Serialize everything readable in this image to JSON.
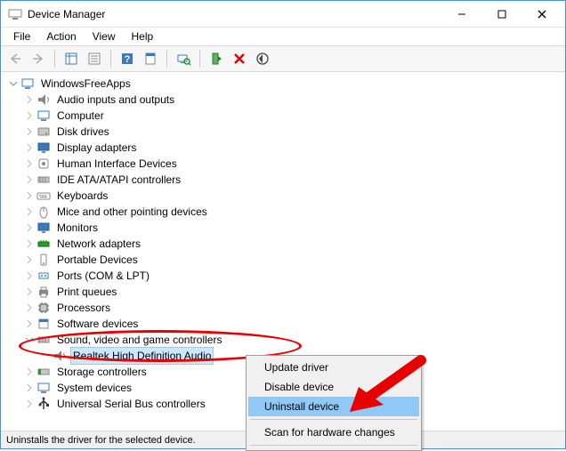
{
  "window": {
    "title": "Device Manager"
  },
  "menu": {
    "file": "File",
    "action": "Action",
    "view": "View",
    "help": "Help"
  },
  "tree": {
    "root": "WindowsFreeApps",
    "items": [
      "Audio inputs and outputs",
      "Computer",
      "Disk drives",
      "Display adapters",
      "Human Interface Devices",
      "IDE ATA/ATAPI controllers",
      "Keyboards",
      "Mice and other pointing devices",
      "Monitors",
      "Network adapters",
      "Portable Devices",
      "Ports (COM & LPT)",
      "Print queues",
      "Processors",
      "Software devices",
      "Sound, video and game controllers",
      "Storage controllers",
      "System devices",
      "Universal Serial Bus controllers"
    ],
    "selected_child": "Realtek High Definition Audio"
  },
  "context_menu": {
    "update": "Update driver",
    "disable": "Disable device",
    "uninstall": "Uninstall device",
    "scan": "Scan for hardware changes"
  },
  "status": "Uninstalls the driver for the selected device."
}
